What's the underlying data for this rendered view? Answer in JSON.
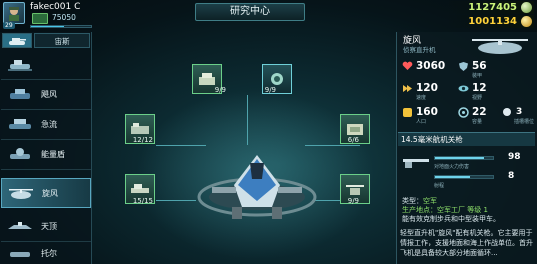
{
  "player": {
    "name": "fakec001 C",
    "level": "29",
    "xp": "75050",
    "xp_progress": 0.55
  },
  "header": {
    "title": "研究中心"
  },
  "resources": {
    "silver": "1127405",
    "gold": "1001134"
  },
  "sidebar": {
    "tabs": [
      {
        "label": "",
        "icon": "tank-icon"
      },
      {
        "label": "宙斯",
        "icon": "aircraft-icon"
      }
    ],
    "units": [
      {
        "name": "飓风",
        "selected": false
      },
      {
        "name": "急流",
        "selected": false
      },
      {
        "name": "能量盾",
        "selected": false
      },
      {
        "name": "旋风",
        "selected": true
      },
      {
        "name": "天顶",
        "selected": false
      },
      {
        "name": "托尔",
        "selected": false
      }
    ]
  },
  "tree": {
    "modules": [
      {
        "id": "m1",
        "count": "9/9"
      },
      {
        "id": "m2",
        "count": "9/9"
      },
      {
        "id": "m3",
        "count": "12/12"
      },
      {
        "id": "m4",
        "count": "6/6"
      },
      {
        "id": "m5",
        "count": "15/15"
      },
      {
        "id": "m6",
        "count": "9/9"
      }
    ]
  },
  "unit": {
    "name": "旋风",
    "subtitle": "侦察直升机",
    "stats": {
      "hp": "3060",
      "armor": "56",
      "armor_label": "装甲",
      "speed": "120",
      "speed_label": "速度",
      "sight": "12",
      "sight_label": "视野",
      "cost": "160",
      "cost_label": "人口",
      "capacity": "22",
      "capacity_label": "容量",
      "slots": "3",
      "slots_label": "插槽槽位"
    },
    "weapon": {
      "name": "14.5毫米航机关枪",
      "damage": "98",
      "damage_label": "对地面火力伤害",
      "damage_fill": 0.85,
      "range": "8",
      "range_label": "射程",
      "range_fill": 0.6
    },
    "type_label": "类型：",
    "type_value": "空军",
    "production": "生产地点：空军工厂 等级 1",
    "note": "能有效克制步兵和中型装甲车。",
    "description": "轻型直升机\"旋风\"配有机关枪。它主要用于情报工作，支援地面和海上作战单位。首升飞机是具备较大部分地面循环..."
  }
}
